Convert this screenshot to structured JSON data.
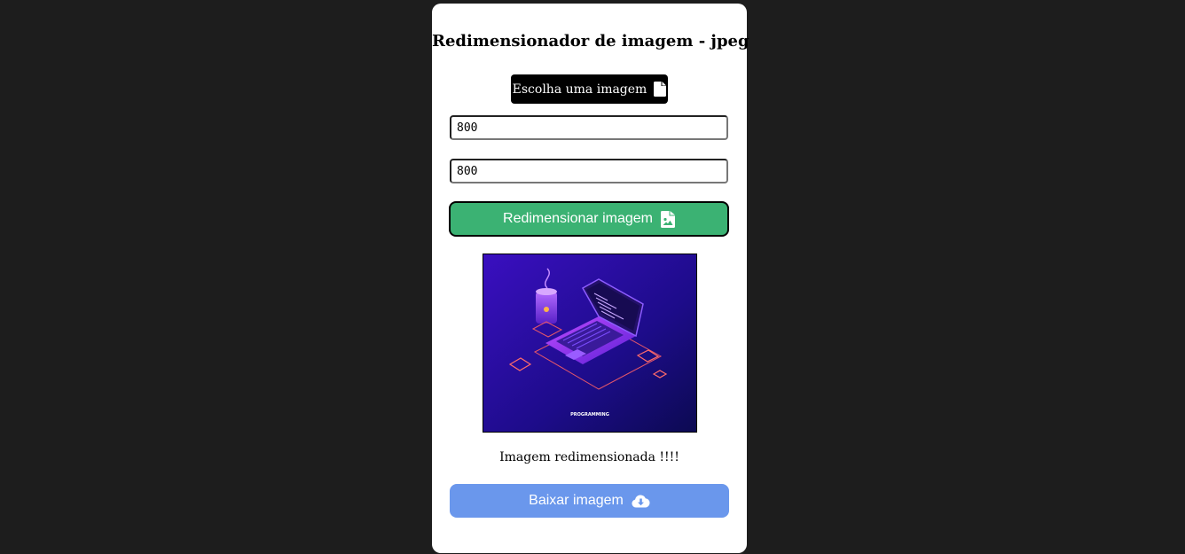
{
  "app": {
    "title": "Redimensionador de imagem - jpeg",
    "choose_label": "Escolha uma imagem",
    "choose_icon": "file-icon",
    "width_value": "800",
    "height_value": "800",
    "resize_label": "Redimensionar imagem",
    "resize_icon": "file-image-icon",
    "preview_caption": "PROGRAMMING",
    "status_text": "Imagem redimensionada !!!!",
    "download_label": "Baixar imagem",
    "download_icon": "cloud-download-icon"
  },
  "colors": {
    "page_background": "#1d1d1d",
    "card_background": "#ffffff",
    "choose_button": "#000000",
    "resize_button": "#3bb273",
    "download_button": "#6a97ec"
  }
}
